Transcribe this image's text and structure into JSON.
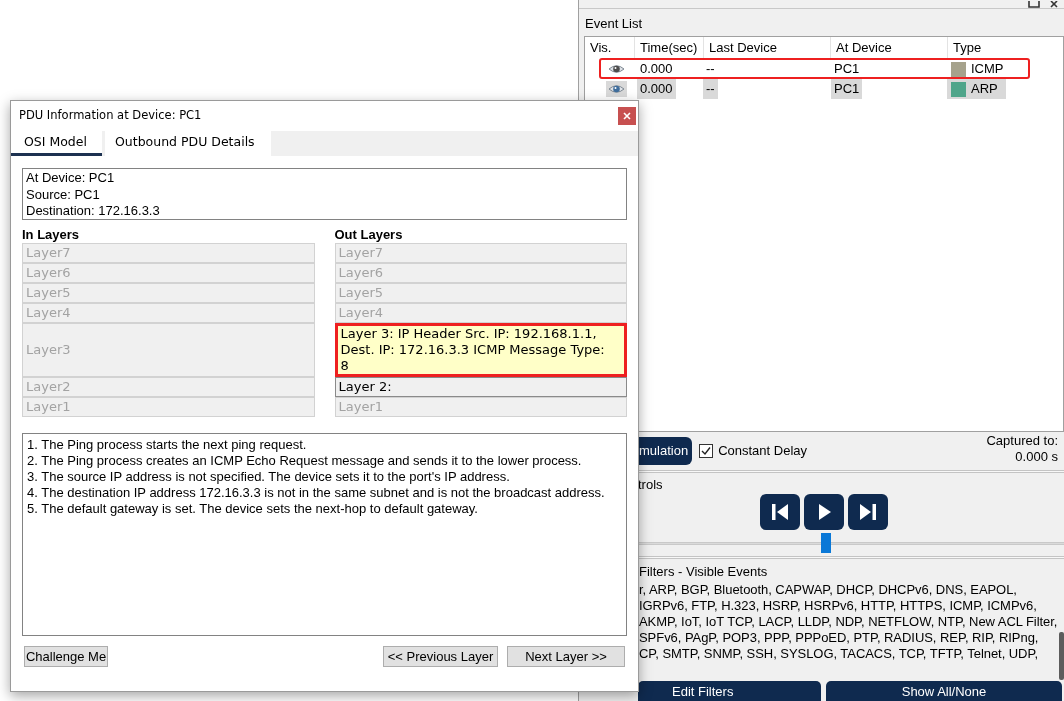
{
  "simulation_panel": {
    "event_list": {
      "label": "Event List",
      "columns": [
        "Vis.",
        "Time(sec)",
        "Last Device",
        "At Device",
        "Type"
      ],
      "rows": [
        {
          "time": "0.000",
          "last_device": "--",
          "at_device": "PC1",
          "type": "ICMP",
          "color": "#a6a28c",
          "selected": false,
          "highlighted": true
        },
        {
          "time": "0.000",
          "last_device": "--",
          "at_device": "PC1",
          "type": "ARP",
          "color": "#4fa58a",
          "selected": true,
          "highlighted": false
        }
      ]
    },
    "reset_button": "mulation",
    "constant_delay": {
      "label": "Constant Delay",
      "checked": true
    },
    "captured": {
      "label": "Captured to:",
      "value": "0.000 s"
    },
    "play_controls": {
      "label": "trols",
      "speed": {
        "level": 0.44
      }
    },
    "event_filters": {
      "label": "Filters - Visible Events",
      "lines": [
        "r, ARP, BGP, Bluetooth, CAPWAP, DHCP, DHCPv6, DNS, EAPOL,",
        "IGRPv6, FTP, H.323, HSRP, HSRPv6, HTTP, HTTPS, ICMP, ICMPv6,",
        "AKMP, IoT, IoT TCP, LACP, LLDP, NDP, NETFLOW, NTP, New ACL Filter,",
        "SPFv6, PAgP, POP3, PPP, PPPoED, PTP, RADIUS, REP, RIP, RIPng,",
        "CP, SMTP, SNMP, SSH, SYSLOG, TACACS, TCP, TFTP, Telnet, UDP,"
      ]
    },
    "buttons": [
      "Edit Filters",
      "Show All/None"
    ]
  },
  "dialog": {
    "title": "PDU Information at Device: PC1",
    "tabs": [
      {
        "label": "OSI Model",
        "selected": true
      },
      {
        "label": "Outbound PDU Details",
        "selected": false
      }
    ],
    "info": [
      "At Device: PC1",
      "Source: PC1",
      "Destination: 172.16.3.3"
    ],
    "in_layers": {
      "heading": "In Layers",
      "layers": [
        {
          "label": "Layer7",
          "active": false,
          "selected": false,
          "highlighted": false
        },
        {
          "label": "Layer6",
          "active": false,
          "selected": false,
          "highlighted": false
        },
        {
          "label": "Layer5",
          "active": false,
          "selected": false,
          "highlighted": false
        },
        {
          "label": "Layer4",
          "active": false,
          "selected": false,
          "highlighted": false
        },
        {
          "label": "Layer3",
          "active": false,
          "selected": false,
          "highlighted": false
        },
        {
          "label": "Layer2",
          "active": false,
          "selected": false,
          "highlighted": false
        },
        {
          "label": "Layer1",
          "active": false,
          "selected": false,
          "highlighted": false
        }
      ]
    },
    "out_layers": {
      "heading": "Out Layers",
      "layers": [
        {
          "label": "Layer7",
          "active": false,
          "selected": false,
          "highlighted": false
        },
        {
          "label": "Layer6",
          "active": false,
          "selected": false,
          "highlighted": false
        },
        {
          "label": "Layer5",
          "active": false,
          "selected": false,
          "highlighted": false
        },
        {
          "label": "Layer4",
          "active": false,
          "selected": false,
          "highlighted": false
        },
        {
          "label": "Layer 3: IP Header Src. IP: 192.168.1.1, Dest. IP: 172.16.3.3 ICMP Message Type: 8",
          "active": true,
          "selected": true,
          "highlighted": true
        },
        {
          "label": "Layer 2:",
          "active": true,
          "selected": false,
          "highlighted": false
        },
        {
          "label": "Layer1",
          "active": false,
          "selected": false,
          "highlighted": false
        }
      ]
    },
    "description": [
      "1. The Ping process starts the next ping request.",
      "2. The Ping process creates an ICMP Echo Request message and sends it to the lower process.",
      "3. The source IP address is not specified. The device sets it to the port's IP address.",
      "4. The destination IP address 172.16.3.3 is not in the same subnet and is not the broadcast address.",
      "5. The default gateway is set. The device sets the next-hop to default gateway."
    ],
    "buttons": [
      "Challenge Me",
      "<< Previous Layer",
      "Next Layer >>"
    ]
  }
}
